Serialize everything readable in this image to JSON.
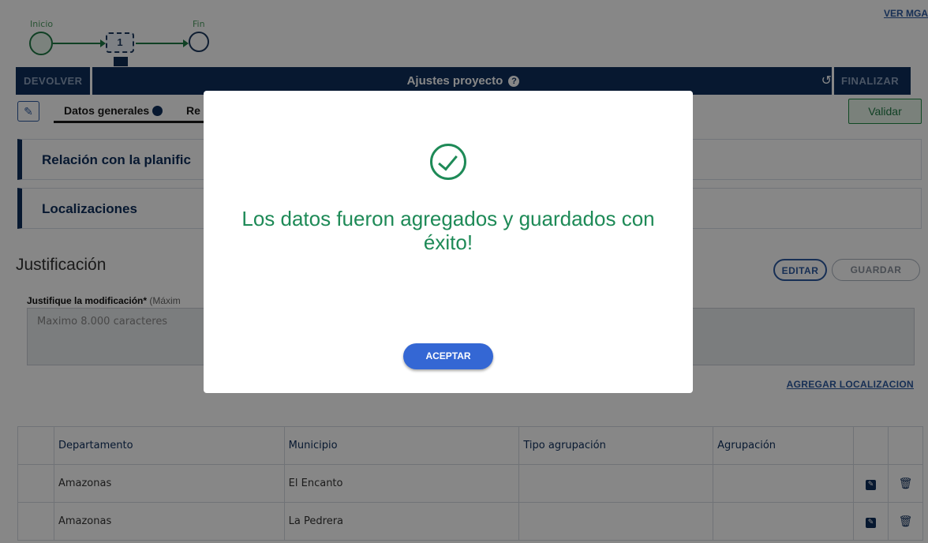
{
  "workflow": {
    "start_label": "Inicio",
    "end_label": "Fin",
    "step_number": "1",
    "link_ver_mga": "VER MGA"
  },
  "toolbar": {
    "devolver": "DEVOLVER",
    "title": "Ajustes proyecto",
    "help_icon": "?",
    "history_icon": "↺",
    "finalizar": "FINALIZAR"
  },
  "tabs": {
    "edit_icon": "✎",
    "datos_generales": "Datos generales",
    "second_partial": "Re"
  },
  "validar": "Validar",
  "sections": {
    "relacion": "Relación con la planific",
    "localizaciones": "Localizaciones"
  },
  "justificacion": {
    "title": "Justificación",
    "editar": "EDITAR",
    "guardar": "GUARDAR",
    "label": "Justifique la modificación*",
    "label_hint": "(Máxim",
    "placeholder": "Maximo 8.000 caracteres",
    "agregar_localizacion": "AGREGAR LOCALIZACION"
  },
  "table": {
    "headers": [
      "Departamento",
      "Municipio",
      "Tipo agrupación",
      "Agrupación"
    ],
    "rows": [
      {
        "departamento": "Amazonas",
        "municipio": "El Encanto",
        "tipo": "",
        "agrupacion": ""
      },
      {
        "departamento": "Amazonas",
        "municipio": "La Pedrera",
        "tipo": "",
        "agrupacion": ""
      }
    ]
  },
  "modal": {
    "message": "Los datos fueron agregados y guardados con éxito!",
    "button": "ACEPTAR"
  },
  "colors": {
    "primary": "#0e2e5c",
    "success": "#1e8a57",
    "button": "#3467d4"
  }
}
